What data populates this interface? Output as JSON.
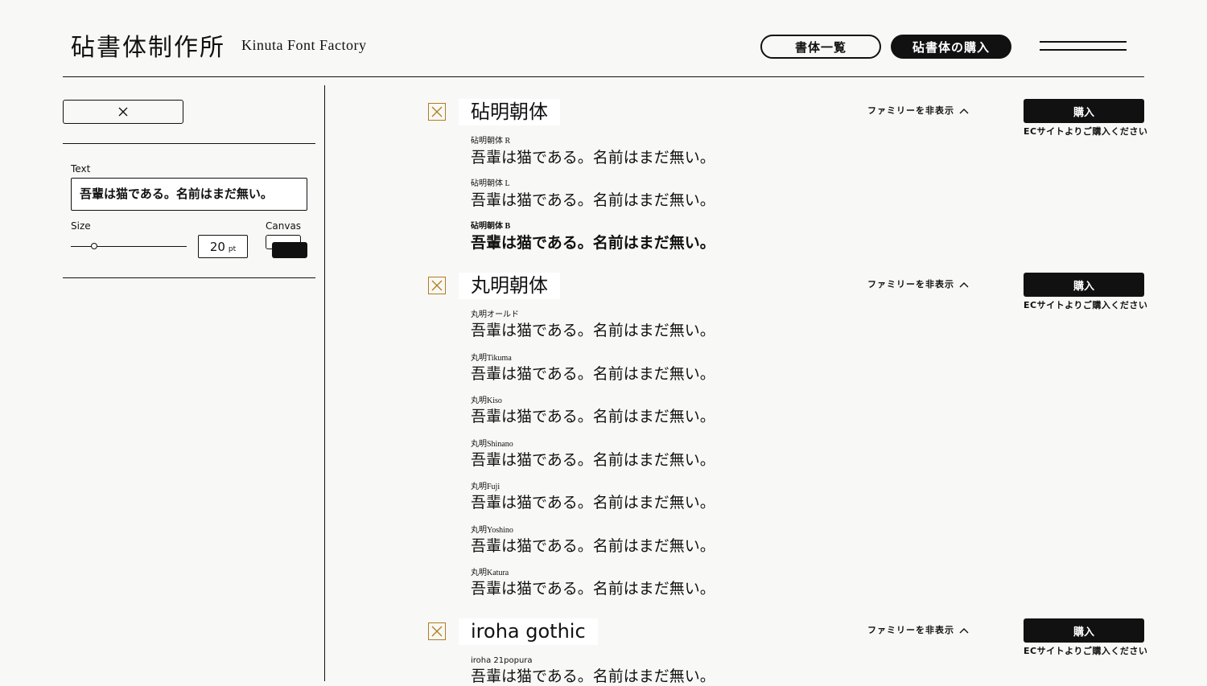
{
  "header": {
    "title": "砧書体制作所",
    "subtitle": "Kinuta Font Factory",
    "nav_list": "書体一覧",
    "nav_buy": "砧書体の購入"
  },
  "sidebar": {
    "text_label": "Text",
    "text_value": "吾輩は猫である。名前はまだ無い。",
    "size_label": "Size",
    "size_value": "20",
    "size_unit": "pt",
    "size_slider_fraction": 0.2,
    "canvas_label": "Canvas"
  },
  "families": [
    {
      "name": "砧明朝体",
      "toggle": "ファミリーを非表示",
      "buy": "購入",
      "buy_note": "ECサイトよりご購入ください",
      "styles": [
        {
          "label": "砧明朝体 R",
          "sample": "吾輩は猫である。名前はまだ無い。"
        },
        {
          "label": "砧明朝体 L",
          "sample": "吾輩は猫である。名前はまだ無い。"
        },
        {
          "label": "砧明朝体 B",
          "sample": "吾輩は猫である。名前はまだ無い。"
        }
      ]
    },
    {
      "name": "丸明朝体",
      "toggle": "ファミリーを非表示",
      "buy": "購入",
      "buy_note": "ECサイトよりご購入ください",
      "styles": [
        {
          "label": "丸明オールド",
          "sample": "吾輩は猫である。名前はまだ無い。"
        },
        {
          "label": "丸明Tikuma",
          "sample": "吾輩は猫である。名前はまだ無い。"
        },
        {
          "label": "丸明Kiso",
          "sample": "吾輩は猫である。名前はまだ無い。"
        },
        {
          "label": "丸明Shinano",
          "sample": "吾輩は猫である。名前はまだ無い。"
        },
        {
          "label": "丸明Fuji",
          "sample": "吾輩は猫である。名前はまだ無い。"
        },
        {
          "label": "丸明Yoshino",
          "sample": "吾輩は猫である。名前はまだ無い。"
        },
        {
          "label": "丸明Katura",
          "sample": "吾輩は猫である。名前はまだ無い。"
        }
      ]
    },
    {
      "name": "iroha gothic",
      "toggle": "ファミリーを非表示",
      "buy": "購入",
      "buy_note": "ECサイトよりご購入ください",
      "styles": [
        {
          "label": "iroha 21popura",
          "sample": "吾輩は猫である。名前はまだ無い。"
        }
      ]
    }
  ],
  "colors": {
    "background": "#f8f8f6",
    "ink": "#111111",
    "checkbox": "#b07d1c"
  },
  "icons": {
    "close": "close-icon",
    "menu": "hamburger-menu-icon",
    "chevron": "chevron-up-icon",
    "checkbox": "x-checkbox-icon"
  }
}
